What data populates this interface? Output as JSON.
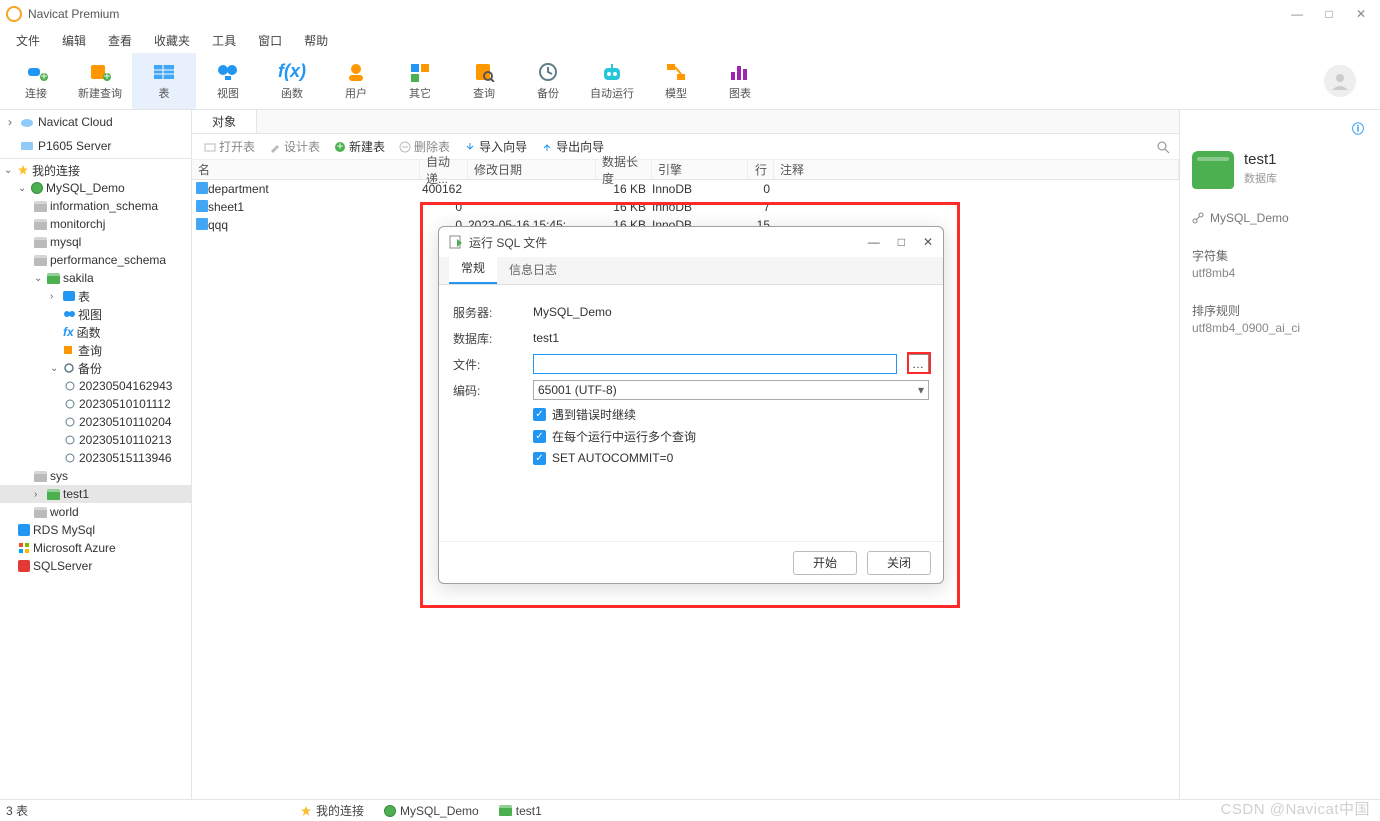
{
  "app": {
    "title": "Navicat Premium"
  },
  "window_controls": {
    "min": "—",
    "max": "□",
    "close": "✕"
  },
  "menu": [
    "文件",
    "编辑",
    "查看",
    "收藏夹",
    "工具",
    "窗口",
    "帮助"
  ],
  "toolbar": [
    {
      "label": "连接",
      "icon": "plug"
    },
    {
      "label": "新建查询",
      "icon": "query"
    },
    {
      "label": "表",
      "icon": "table",
      "active": true
    },
    {
      "label": "视图",
      "icon": "view"
    },
    {
      "label": "函数",
      "icon": "fx"
    },
    {
      "label": "用户",
      "icon": "user"
    },
    {
      "label": "其它",
      "icon": "other"
    },
    {
      "label": "查询",
      "icon": "search"
    },
    {
      "label": "备份",
      "icon": "backup"
    },
    {
      "label": "自动运行",
      "icon": "robot"
    },
    {
      "label": "模型",
      "icon": "model"
    },
    {
      "label": "图表",
      "icon": "chart"
    }
  ],
  "cloud": {
    "navicat_cloud": "Navicat Cloud",
    "server": "P1605 Server"
  },
  "tree": {
    "root_my_conn": "我的连接",
    "conn_mysql_demo": "MySQL_Demo",
    "dbs_gray": [
      "information_schema",
      "monitorchj",
      "mysql",
      "performance_schema"
    ],
    "sakila": "sakila",
    "sakila_children": [
      "表",
      "视图",
      "函数",
      "查询",
      "备份"
    ],
    "backups": [
      "20230504162943",
      "20230510101112",
      "20230510110204",
      "20230510110213",
      "20230515113946"
    ],
    "sys": "sys",
    "test1": "test1",
    "world": "world",
    "rds": "RDS MySql",
    "azure": "Microsoft Azure",
    "sqlserver": "SQLServer"
  },
  "sub_tabs": {
    "objects": "对象"
  },
  "sub_toolbar": {
    "open": "打开表",
    "design": "设计表",
    "new": "新建表",
    "delete": "删除表",
    "import": "导入向导",
    "export": "导出向导"
  },
  "table_headers": {
    "name": "名",
    "auto": "自动递...",
    "date": "修改日期",
    "size": "数据长度",
    "engine": "引擎",
    "rows": "行",
    "remark": "注释"
  },
  "tables": [
    {
      "name": "department",
      "auto": "400162",
      "date": "",
      "size": "16 KB",
      "engine": "InnoDB",
      "rows": "0"
    },
    {
      "name": "sheet1",
      "auto": "0",
      "date": "",
      "size": "16 KB",
      "engine": "InnoDB",
      "rows": "7"
    },
    {
      "name": "qqq",
      "auto": "0",
      "date": "2023-05-16 15:45:...",
      "size": "16 KB",
      "engine": "InnoDB",
      "rows": "15"
    }
  ],
  "right_info": {
    "title": "test1",
    "subtitle": "数据库",
    "link": "MySQL_Demo",
    "charset_label": "字符集",
    "charset": "utf8mb4",
    "collation_label": "排序规则",
    "collation": "utf8mb4_0900_ai_ci",
    "info_icon": "ⓘ"
  },
  "dialog": {
    "title": "运行 SQL 文件",
    "tabs": {
      "general": "常规",
      "log": "信息日志"
    },
    "labels": {
      "server": "服务器:",
      "database": "数据库:",
      "file": "文件:",
      "encoding": "编码:"
    },
    "values": {
      "server": "MySQL_Demo",
      "database": "test1",
      "encoding": "65001 (UTF-8)"
    },
    "checks": [
      "遇到错误时继续",
      "在每个运行中运行多个查询",
      "SET AUTOCOMMIT=0"
    ],
    "buttons": {
      "start": "开始",
      "close": "关闭"
    },
    "browse": "…"
  },
  "statusbar": {
    "left": "3 表",
    "conn": "我的连接",
    "db": "MySQL_Demo",
    "schema": "test1"
  },
  "watermark": "CSDN @Navicat中国"
}
